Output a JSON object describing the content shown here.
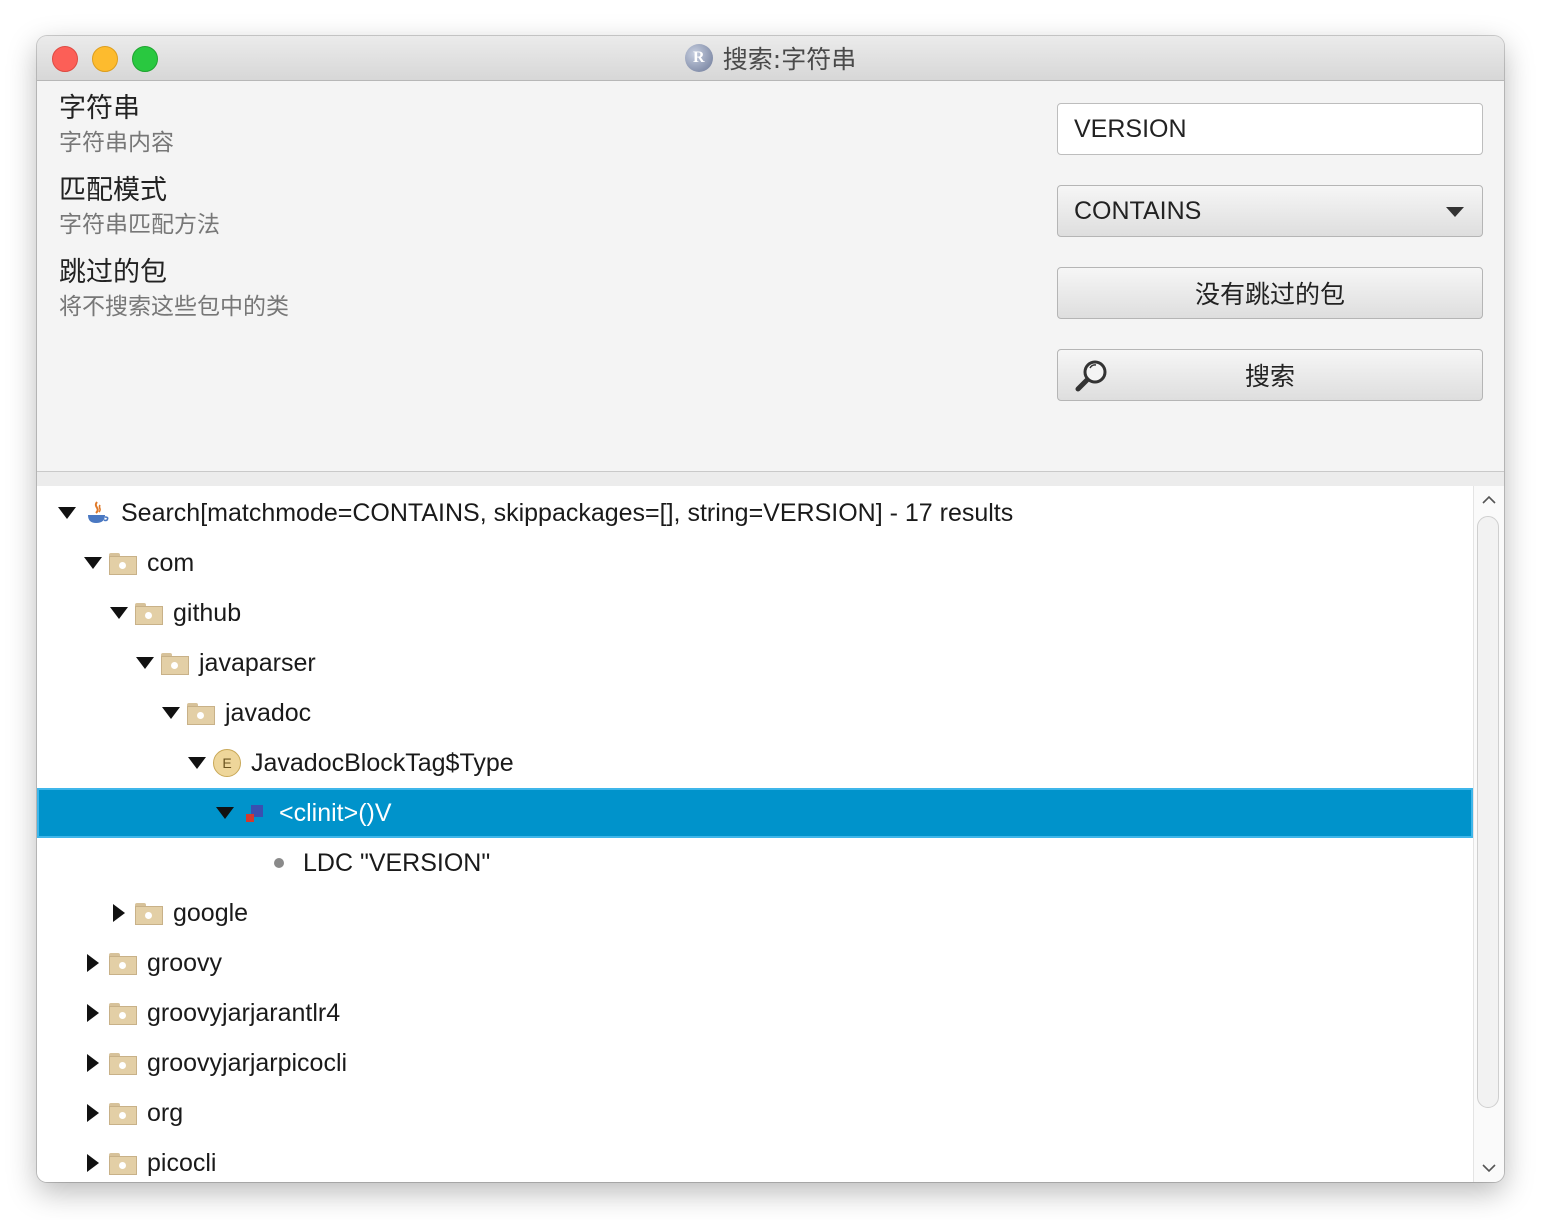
{
  "window": {
    "title": "搜索:字符串"
  },
  "form": {
    "string_label": "字符串",
    "string_desc": "字符串内容",
    "match_label": "匹配模式",
    "match_desc": "字符串匹配方法",
    "skip_label": "跳过的包",
    "skip_desc": "将不搜索这些包中的类",
    "string_value": "VERSION",
    "match_value": "CONTAINS",
    "skip_button": "没有跳过的包",
    "search_button": "搜索"
  },
  "tree": {
    "rows": [
      {
        "label": "Search[matchmode=CONTAINS, skippackages=[], string=VERSION] - 17 results",
        "depth": 0,
        "toggle": "expanded",
        "icon": "search-result-icon"
      },
      {
        "label": "com",
        "depth": 1,
        "toggle": "expanded",
        "icon": "folder-icon"
      },
      {
        "label": "github",
        "depth": 2,
        "toggle": "expanded",
        "icon": "folder-icon"
      },
      {
        "label": "javaparser",
        "depth": 3,
        "toggle": "expanded",
        "icon": "folder-icon"
      },
      {
        "label": "javadoc",
        "depth": 4,
        "toggle": "expanded",
        "icon": "folder-icon"
      },
      {
        "label": "JavadocBlockTag$Type",
        "depth": 5,
        "toggle": "expanded",
        "icon": "enum-icon",
        "icon_text": "E"
      },
      {
        "label": "<clinit>()V",
        "depth": 6,
        "toggle": "expanded",
        "icon": "method-icon",
        "selected": true
      },
      {
        "label": "LDC \"VERSION\"",
        "depth": 7,
        "toggle": "none",
        "icon": "instruction-bullet-icon"
      },
      {
        "label": "google",
        "depth": 2,
        "toggle": "collapsed",
        "icon": "folder-icon"
      },
      {
        "label": "groovy",
        "depth": 1,
        "toggle": "collapsed",
        "icon": "folder-icon"
      },
      {
        "label": "groovyjarjarantlr4",
        "depth": 1,
        "toggle": "collapsed",
        "icon": "folder-icon"
      },
      {
        "label": "groovyjarjarpicocli",
        "depth": 1,
        "toggle": "collapsed",
        "icon": "folder-icon"
      },
      {
        "label": "org",
        "depth": 1,
        "toggle": "collapsed",
        "icon": "folder-icon"
      },
      {
        "label": "picocli",
        "depth": 1,
        "toggle": "collapsed",
        "icon": "folder-icon"
      }
    ]
  },
  "colors": {
    "selection": "#0093cb",
    "folder": "#e3cfa6"
  }
}
